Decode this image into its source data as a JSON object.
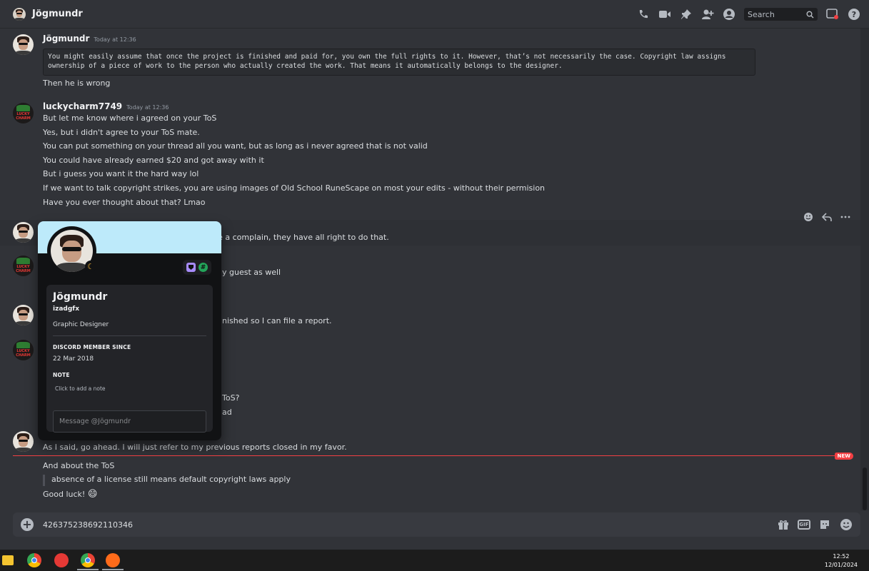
{
  "header": {
    "channel_name": "Jögmundr",
    "search_placeholder": "Search",
    "icons": [
      "phone-call-icon",
      "video-icon",
      "pin-icon",
      "add-friend-icon",
      "profile-icon",
      "inbox-icon",
      "help-icon"
    ]
  },
  "messages": {
    "group1": {
      "author": "Jögmundr",
      "timestamp": "Today at 12:36",
      "code_line1": "You might easily assume that once the project is finished and paid for, you own the full rights to it. However, that’s not necessarily the case. Copyright law assigns",
      "code_line2": "ownership of a piece of work to the person who actually created the work. That means it automatically belongs to the designer.",
      "line1": "Then he is wrong"
    },
    "group2": {
      "author": "luckycharm7749",
      "timestamp": "Today at 12:36",
      "lines": [
        "But let me know where i agreed on your ToS",
        "Yes, but i didn't agree to your ToS mate.",
        "You can put something on your thread all you want, but as long as i never agreed that is not valid",
        "You could have already earned $20 and got away with it",
        "But i guess you want it the hard way lol",
        "If we want to talk copyright strikes, you are using images of Old School RuneScape on most your edits - without their permision",
        "Have you ever thought about that? Lmao"
      ]
    },
    "partial": {
      "p1": "ile a complain, they have all right to do that.",
      "p2": "y guest as well",
      "p3": "nished so I can file a report.",
      "p4": "ToS?",
      "p5": "ad",
      "p6": "As I said, go ahead. I will just refer to my previous reports closed in my favor."
    },
    "new_label": "NEW",
    "after_new": {
      "line1": "And about the ToS",
      "quote": "absence of a license still means default copyright laws apply",
      "line3": "Good luck!",
      "emoji": "😄"
    }
  },
  "input": {
    "value": "426375238692110346",
    "icons": [
      "gift-icon",
      "gif-icon",
      "sticker-icon",
      "emoji-icon"
    ],
    "gif_label": "GIF"
  },
  "profile_popout": {
    "display_name": "Jögmundr",
    "username": "izadgfx",
    "bio": "Graphic Designer",
    "member_since_heading": "Discord Member Since",
    "member_since": "22 Mar 2018",
    "note_heading": "Note",
    "note_placeholder": "Click to add a note",
    "message_placeholder": "Message @Jögmundr",
    "banner_color": "#bdeafa",
    "status": "idle"
  },
  "taskbar": {
    "time": "12:52",
    "date": "12/01/2024"
  },
  "colors": {
    "background": "#313338",
    "accent_red": "#f23f43",
    "idle": "#f0b232"
  }
}
